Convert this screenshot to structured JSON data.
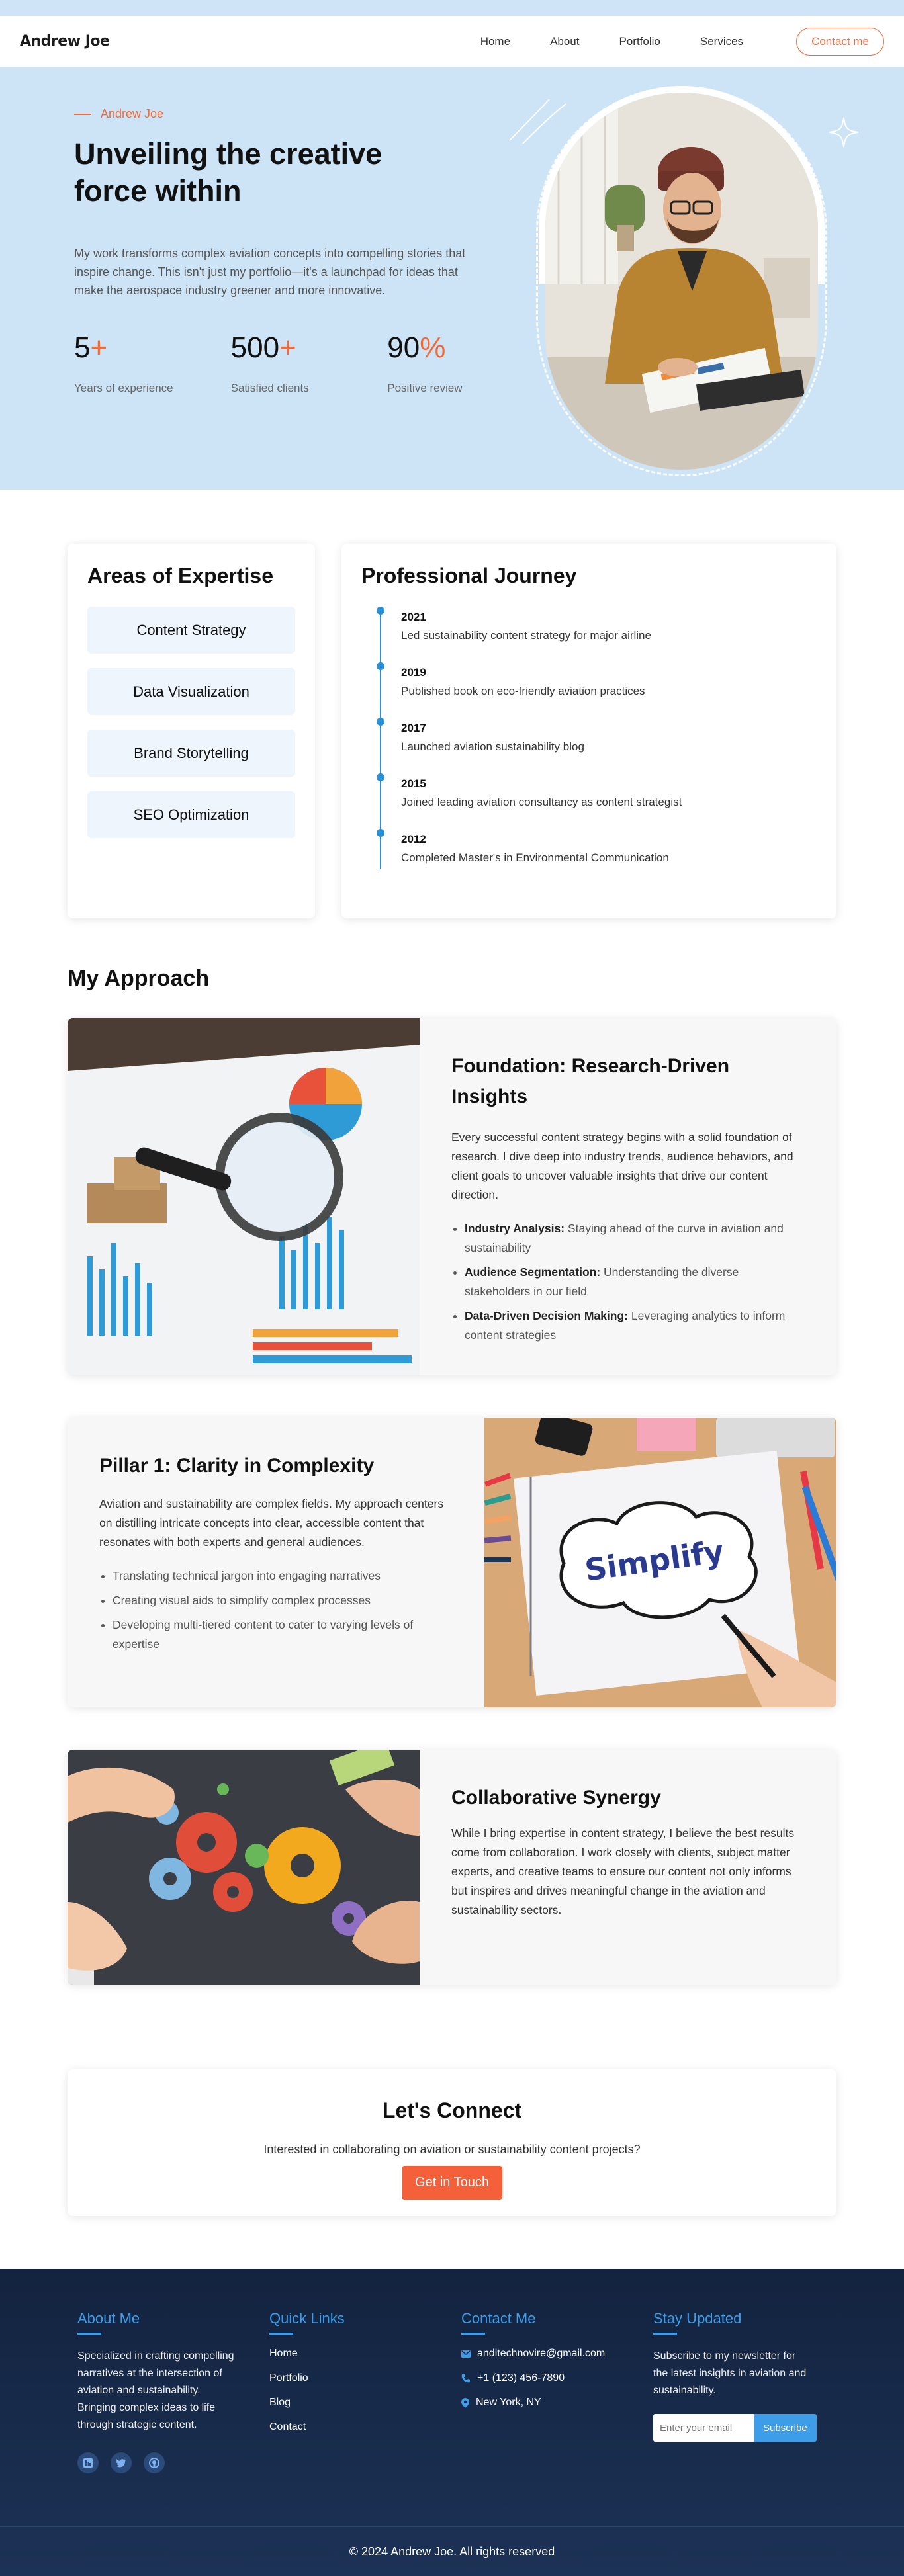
{
  "nav": {
    "brand": "Andrew Joe",
    "links": [
      "Home",
      "About",
      "Portfolio",
      "Services"
    ],
    "cta": "Contact me"
  },
  "hero": {
    "eyebrow": "Andrew Joe",
    "title_line1": "Unveiling the creative",
    "title_line2": "force within",
    "description": "My work transforms complex aviation concepts into compelling stories that inspire change. This isn't just my portfolio—it's a launchpad for ideas that make the aerospace industry greener and more innovative.",
    "stats": [
      {
        "value": "5",
        "suffix": "+",
        "label": "Years of experience"
      },
      {
        "value": "500",
        "suffix": "+",
        "label": "Satisfied clients"
      },
      {
        "value": "90",
        "suffix": "%",
        "label": "Positive review"
      }
    ]
  },
  "expertise": {
    "title": "Areas of Expertise",
    "items": [
      "Content Strategy",
      "Data Visualization",
      "Brand Storytelling",
      "SEO Optimization"
    ]
  },
  "journey": {
    "title": "Professional Journey",
    "items": [
      {
        "year": "2021",
        "text": "Led sustainability content strategy for major airline"
      },
      {
        "year": "2019",
        "text": "Published book on eco-friendly aviation practices"
      },
      {
        "year": "2017",
        "text": "Launched aviation sustainability blog"
      },
      {
        "year": "2015",
        "text": "Joined leading aviation consultancy as content strategist"
      },
      {
        "year": "2012",
        "text": "Completed Master's in Environmental Communication"
      }
    ]
  },
  "approach": {
    "title": "My Approach",
    "foundation": {
      "title_line1": "Foundation: Research-Driven",
      "title_line2": "Insights",
      "text": "Every successful content strategy begins with a solid foundation of research. I dive deep into industry trends, audience behaviors, and client goals to uncover valuable insights that drive our content direction.",
      "bullets": [
        {
          "head": "Industry Analysis:",
          "text": " Staying ahead of the curve in aviation and sustainability"
        },
        {
          "head": "Audience Segmentation:",
          "text": " Understanding the diverse stakeholders in our field"
        },
        {
          "head": "Data-Driven Decision Making:",
          "text": " Leveraging analytics to inform content strategies"
        }
      ]
    },
    "pillar1": {
      "title": "Pillar 1: Clarity in Complexity",
      "text": "Aviation and sustainability are complex fields. My approach centers on distilling intricate concepts into clear, accessible content that resonates with both experts and general audiences.",
      "bullets": [
        "Translating technical jargon into engaging narratives",
        "Creating visual aids to simplify complex processes",
        "Developing multi-tiered content to cater to varying levels of expertise"
      ],
      "image_word": "Simplify"
    },
    "synergy": {
      "title": "Collaborative Synergy",
      "text": "While I bring expertise in content strategy, I believe the best results come from collaboration. I work closely with clients, subject matter experts, and creative teams to ensure our content not only informs but inspires and drives meaningful change in the aviation and sustainability sectors."
    }
  },
  "connect": {
    "title": "Let's Connect",
    "text": "Interested in collaborating on aviation or sustainability content projects?",
    "button": "Get in Touch"
  },
  "footer": {
    "about_title": "About Me",
    "about_text": "Specialized in crafting compelling narratives at the intersection of aviation and sustainability. Bringing complex ideas to life through strategic content.",
    "links_title": "Quick Links",
    "links": [
      "Home",
      "Portfolio",
      "Blog",
      "Contact"
    ],
    "contact_title": "Contact Me",
    "email": "anditechnovire@gmail.com",
    "phone": "+1 (123) 456-7890",
    "location": "New York, NY",
    "newsletter_title": "Stay Updated",
    "newsletter_text": "Subscribe to my newsletter for the latest insights in aviation and sustainability.",
    "newsletter_placeholder": "Enter your email",
    "newsletter_button": "Subscribe",
    "copyright": "© 2024 Andrew Joe. All rights reserved"
  },
  "colors": {
    "accent": "#f06a3a",
    "hero_bg": "#cce4f6",
    "timeline_blue": "#2b8fd6",
    "footer_bg": "#13233f",
    "footer_heading": "#3d9de8"
  },
  "icons": [
    "sparkle-icon",
    "mail-icon",
    "phone-icon",
    "location-icon",
    "linkedin-icon",
    "twitter-icon",
    "github-icon"
  ]
}
